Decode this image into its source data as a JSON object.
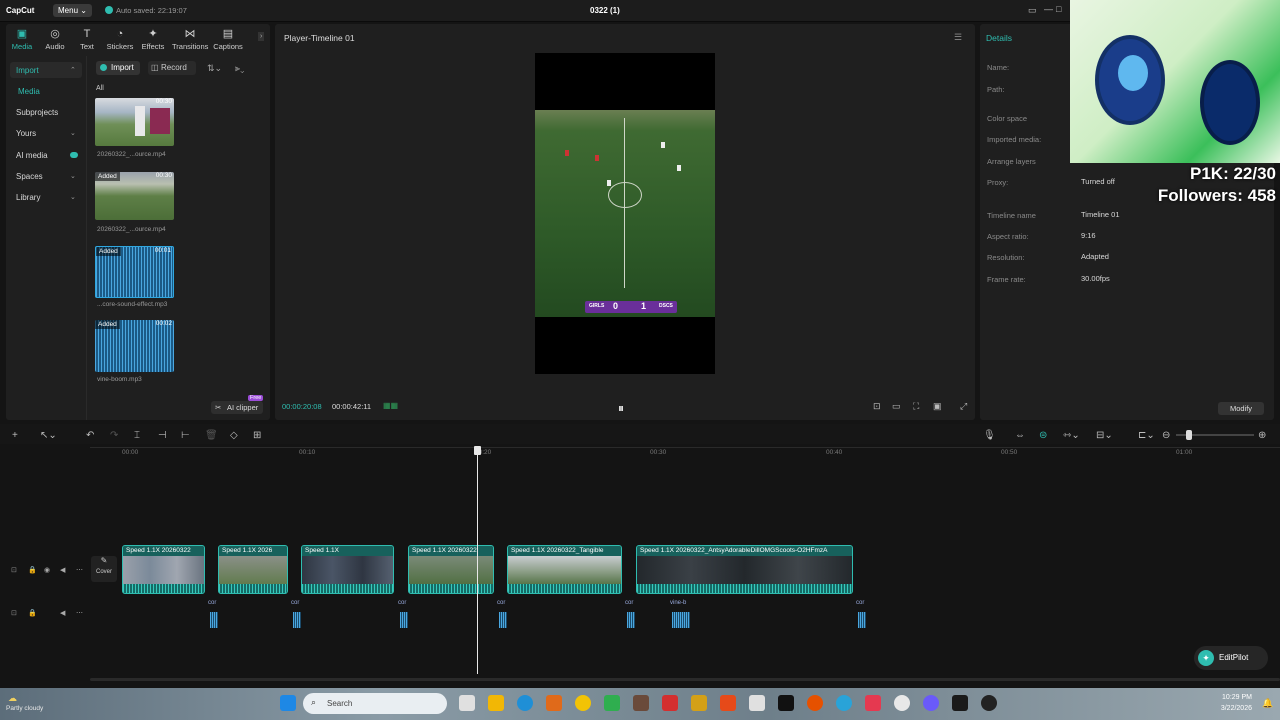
{
  "titlebar": {
    "app": "CapCut",
    "menu": "Menu",
    "autosave": "Auto saved: 22:19:07",
    "project": "0322 (1)"
  },
  "tabs": [
    {
      "label": "Media",
      "icon": "media-icon"
    },
    {
      "label": "Audio",
      "icon": "audio-icon"
    },
    {
      "label": "Text",
      "icon": "text-icon"
    },
    {
      "label": "Stickers",
      "icon": "stickers-icon"
    },
    {
      "label": "Effects",
      "icon": "effects-icon"
    },
    {
      "label": "Transitions",
      "icon": "transitions-icon"
    },
    {
      "label": "Captions",
      "icon": "captions-icon"
    }
  ],
  "left_nav": {
    "import": "Import",
    "media": "Media",
    "subprojects": "Subprojects",
    "yours": "Yours",
    "ai_media": "AI media",
    "spaces": "Spaces",
    "library": "Library"
  },
  "media_toolbar": {
    "import": "Import",
    "record": "Record",
    "filter_all": "All"
  },
  "media_items": [
    {
      "badge": "",
      "duration": "00:30",
      "caption": "20260322_...ource.mp4"
    },
    {
      "badge": "Added",
      "duration": "00:30",
      "caption": "20260322_...ource.mp4"
    },
    {
      "badge": "Added",
      "duration": "00:01",
      "caption": "...core-sound-effect.mp3"
    },
    {
      "badge": "Added",
      "duration": "00:02",
      "caption": "vine-boom.mp3"
    }
  ],
  "ai_clipper": {
    "label": "AI clipper",
    "tag": "Free"
  },
  "player": {
    "title": "Player-Timeline 01",
    "current": "00:00:20:08",
    "total": "00:00:42:11",
    "score_left": "0",
    "score_right": "1",
    "team_left": "GIRLS",
    "team_right": "DSCS"
  },
  "details": {
    "title": "Details",
    "rows": [
      {
        "label": "Name:",
        "value": ""
      },
      {
        "label": "Path:",
        "value": ""
      },
      {
        "label": "Color space",
        "value": ""
      },
      {
        "label": "Imported media:",
        "value": ""
      },
      {
        "label": "Arrange layers",
        "value": ""
      },
      {
        "label": "Proxy:",
        "value": "Turned off"
      },
      {
        "label": "Timeline name",
        "value": "Timeline 01"
      },
      {
        "label": "Aspect ratio:",
        "value": "9:16"
      },
      {
        "label": "Resolution:",
        "value": "Adapted"
      },
      {
        "label": "Frame rate:",
        "value": "30.00fps"
      }
    ],
    "modify": "Modify"
  },
  "stream_overlay": {
    "line1": "P1K: 22/30",
    "line2": "Followers: 458"
  },
  "timeline": {
    "ruler": [
      "00:00",
      "00:10",
      "00:20",
      "00:30",
      "00:40",
      "00:50",
      "01:00"
    ],
    "cover": "Cover",
    "clips": [
      {
        "label": "Speed 1.1X  20260322",
        "color": "#8a8e9a"
      },
      {
        "label": "Speed 1.1X  2026",
        "color": "#7b8a6a"
      },
      {
        "label": "Speed 1.1X",
        "color": "#3c4452"
      },
      {
        "label": "Speed 1.1X  20260322",
        "color": "#5f7a55"
      },
      {
        "label": "Speed 1.1X  20260322_Tangible",
        "color": "#8a9a8a"
      },
      {
        "label": "Speed 1.1X  20260322_AntsyAdorableDillOMGScoots-O2HFmzA",
        "color": "#2f3438"
      }
    ],
    "audio_clips": [
      "cor",
      "cor",
      "cor",
      "cor",
      "cor",
      "vine-b",
      "cor"
    ]
  },
  "editpilot": "EditPilot",
  "taskbar": {
    "weather_temp": "",
    "weather_text": "Partly cloudy",
    "search": "Search",
    "time": "10:29 PM",
    "date": "3/22/2026"
  },
  "colors": {
    "accent": "#2fbdb0",
    "bg": "#141414",
    "panel": "#1f1f1f"
  }
}
